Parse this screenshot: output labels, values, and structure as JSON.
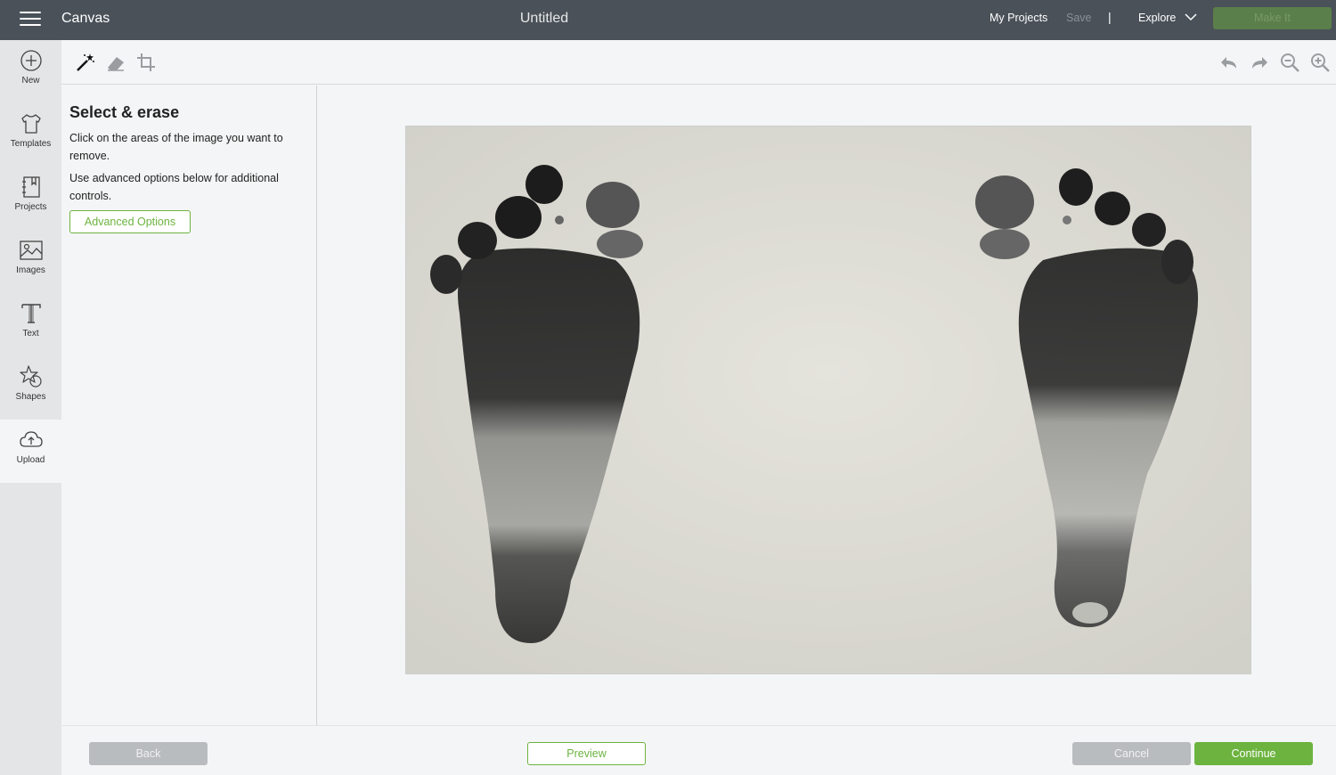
{
  "topbar": {
    "app_name": "Canvas",
    "doc_title": "Untitled",
    "my_projects": "My Projects",
    "save": "Save",
    "separator": "|",
    "explore": "Explore",
    "make_it": "Make It"
  },
  "rail": {
    "items": [
      {
        "label": "New",
        "icon": "plus-circle-icon"
      },
      {
        "label": "Templates",
        "icon": "tshirt-icon"
      },
      {
        "label": "Projects",
        "icon": "projects-icon"
      },
      {
        "label": "Images",
        "icon": "image-icon"
      },
      {
        "label": "Text",
        "icon": "text-icon"
      },
      {
        "label": "Shapes",
        "icon": "shapes-icon"
      },
      {
        "label": "Upload",
        "icon": "cloud-upload-icon"
      }
    ],
    "active": "Upload"
  },
  "tools": {
    "left": [
      "magic-wand-icon",
      "eraser-icon",
      "crop-icon"
    ],
    "right": [
      "undo-icon",
      "redo-icon",
      "zoom-out-icon",
      "zoom-in-icon"
    ]
  },
  "panel": {
    "title": "Select & erase",
    "para1": "Click on the areas of the image you want to remove.",
    "para2": "Use advanced options below for additional controls.",
    "advanced_button": "Advanced Options"
  },
  "footer": {
    "back": "Back",
    "preview": "Preview",
    "cancel": "Cancel",
    "continue": "Continue"
  },
  "colors": {
    "topbar": "#4a5159",
    "accent_green": "#6cb33f",
    "disabled_gray": "#b9bcbf"
  }
}
